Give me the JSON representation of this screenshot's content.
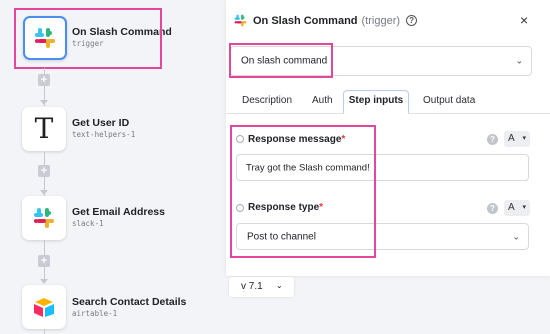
{
  "workflow": {
    "steps": [
      {
        "title": "On Slash Command",
        "subtitle": "trigger",
        "icon": "slack-icon"
      },
      {
        "title": "Get User ID",
        "subtitle": "text-helpers-1",
        "icon": "text-helpers-icon",
        "glyph": "T"
      },
      {
        "title": "Get Email Address",
        "subtitle": "slack-1",
        "icon": "slack-icon"
      },
      {
        "title": "Search Contact Details",
        "subtitle": "airtable-1",
        "icon": "airtable-icon"
      }
    ],
    "add_glyph": "+"
  },
  "panel": {
    "title": "On Slash Command",
    "title_suffix": "(trigger)",
    "help_glyph": "?",
    "close_glyph": "×",
    "operation": {
      "value": "On slash command",
      "chevron": "⌄"
    },
    "tabs": [
      {
        "label": "Description",
        "active": false
      },
      {
        "label": "Auth",
        "active": false
      },
      {
        "label": "Step inputs",
        "active": true
      },
      {
        "label": "Output data",
        "active": false
      }
    ],
    "fields": [
      {
        "label": "Response message",
        "required_mark": "*",
        "value": "Tray got the Slash command!",
        "help_glyph": "?",
        "type_glyph": "A",
        "type_caret": "▾"
      },
      {
        "label": "Response type",
        "required_mark": "*",
        "value": "Post to channel",
        "help_glyph": "?",
        "type_glyph": "A",
        "type_caret": "▾",
        "chevron": "⌄"
      }
    ]
  },
  "version": {
    "value": "v 7.1",
    "chevron": "⌄"
  },
  "colors": {
    "highlight": "#e2479c",
    "active_border": "#4a8ef0",
    "required": "#e33b3b",
    "slack": [
      "#36c5f0",
      "#2eb67d",
      "#ecb22e",
      "#e01e5a"
    ],
    "airtable": [
      "#fcb400",
      "#18bfff",
      "#f82b60"
    ]
  }
}
